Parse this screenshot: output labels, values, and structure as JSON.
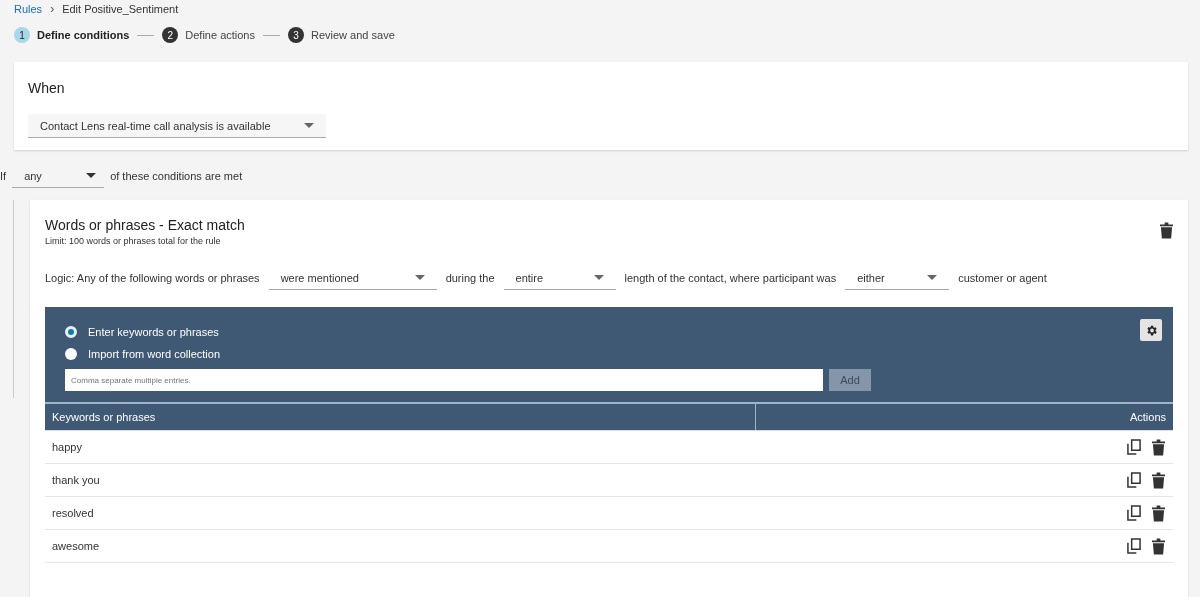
{
  "breadcrumb": {
    "link": "Rules",
    "separator": "›",
    "current": "Edit Positive_Sentiment"
  },
  "steps": [
    {
      "number": "1",
      "label": "Define conditions",
      "selected": true
    },
    {
      "number": "2",
      "label": "Define actions",
      "selected": false
    },
    {
      "number": "3",
      "label": "Review and save",
      "selected": false
    }
  ],
  "when": {
    "title": "When",
    "value": "Contact Lens real-time call analysis is available"
  },
  "if_row": {
    "prefix": "If",
    "value": "any",
    "suffix": "of these conditions are met"
  },
  "condition": {
    "title": "Words or phrases - Exact match",
    "limit": "Limit: 100 words or phrases total for the rule",
    "logic": [
      {
        "kind": "text",
        "text": "Logic: Any of the following words or phrases"
      },
      {
        "kind": "select",
        "text": "were mentioned"
      },
      {
        "kind": "text",
        "text": "during the"
      },
      {
        "kind": "select",
        "text": "entire"
      },
      {
        "kind": "text",
        "text": "length of the contact, where participant was"
      },
      {
        "kind": "select",
        "text": "either"
      },
      {
        "kind": "text",
        "text": "customer or agent"
      }
    ],
    "options": [
      {
        "label": "Enter keywords or phrases",
        "selected": true
      },
      {
        "label": "Import from word collection",
        "selected": false
      }
    ],
    "input": {
      "placeholder": "Comma separate multiple entries."
    },
    "add_button": "Add",
    "table": {
      "columns": [
        "Keywords or phrases",
        "Actions"
      ],
      "rows": [
        {
          "keyword": "happy"
        },
        {
          "keyword": "thank you"
        },
        {
          "keyword": "resolved"
        },
        {
          "keyword": "awesome"
        }
      ]
    }
  }
}
